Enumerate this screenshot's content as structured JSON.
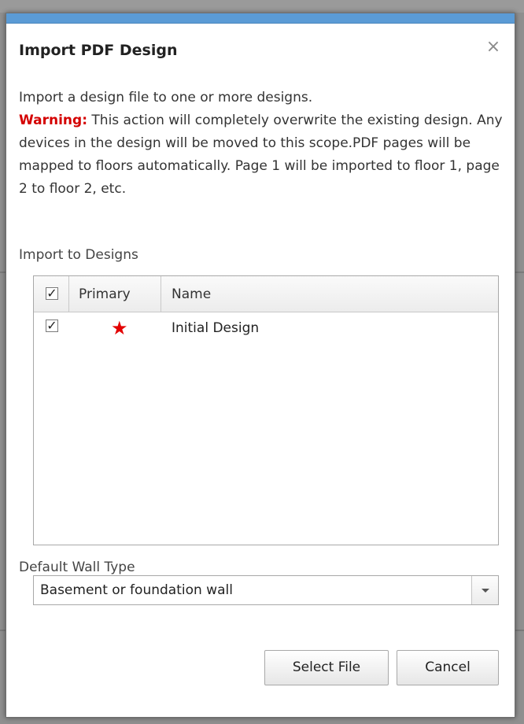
{
  "dialog": {
    "title": "Import PDF Design",
    "close_symbol": "×",
    "description": {
      "line1": "Import a design file to one or more designs.",
      "warning_label": "Warning:",
      "warning_text": " This action will completely overwrite the existing design. Any devices in the design will be moved to this scope.PDF pages will be mapped to floors automatically. Page 1 will be imported to floor 1, page 2 to floor 2, etc."
    },
    "designs_section_label": "Import to Designs",
    "grid": {
      "columns": [
        "",
        "Primary",
        "Name"
      ],
      "rows": [
        {
          "checked": true,
          "primary": true,
          "name": "Initial Design"
        }
      ]
    },
    "wall_type_label": "Default Wall Type",
    "wall_type_value": "Basement or foundation wall",
    "buttons": {
      "select_file": "Select File",
      "cancel": "Cancel"
    }
  },
  "icons": {
    "close": "close-icon",
    "checkbox": "checkmark-icon",
    "primary": "star-icon",
    "dropdown": "chevron-down-icon"
  },
  "colors": {
    "accent": "#5b9bd5",
    "warning": "#d40000",
    "primary_star": "#e30000"
  }
}
